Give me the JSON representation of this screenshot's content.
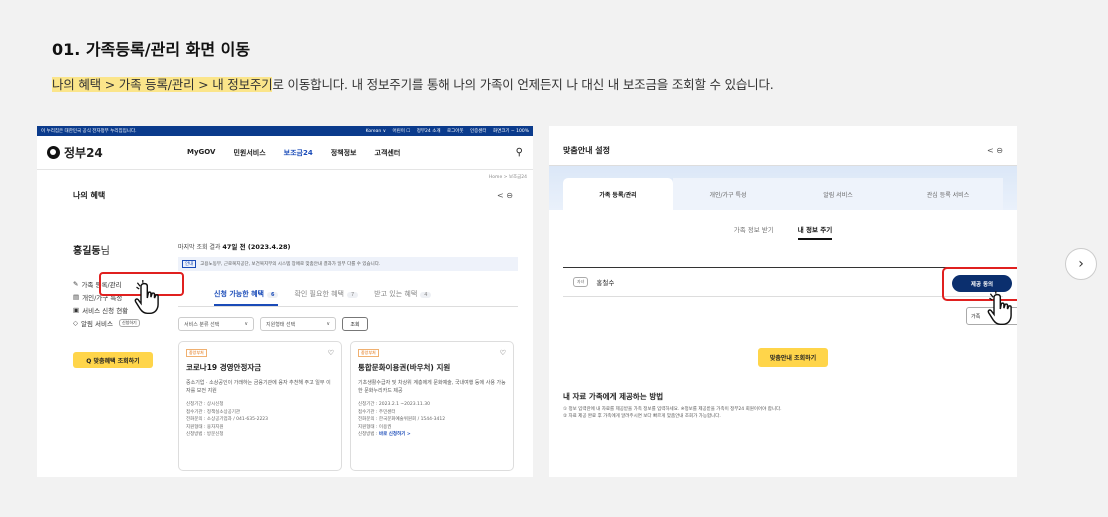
{
  "title": "01. 가족등록/관리 화면 이동",
  "description": {
    "highlight": "나의 혜택 > 가족 등록/관리 > 내 정보주기",
    "rest": "로 이동합니다. 내 정보주기를 통해 나의 가족이 언제든지 나 대신 내 보조금을 조회할 수 있습니다."
  },
  "left": {
    "top_bar": {
      "notice": "이 누리집은 대한민국 공식 전자정부 누리집입니다.",
      "links": [
        "Korean ∨",
        "어린이 ☐",
        "정부24 소개",
        "로그아웃",
        "인증센터",
        "화면크기 − 100%"
      ]
    },
    "logo": "정부24",
    "nav": [
      "MyGOV",
      "민원서비스",
      "보조금24",
      "정책정보",
      "고객센터"
    ],
    "search_icon": "search-icon",
    "breadcrumb": "Home > 보조금24",
    "section_title": "나의 혜택",
    "share_print": "< ⊖",
    "user_name": "홍길동",
    "user_suffix": "님",
    "sidebar": [
      {
        "icon": "✎",
        "label": "가족 등록/관리"
      },
      {
        "icon": "▤",
        "label": "개인/가구 특성"
      },
      {
        "icon": "▣",
        "label": "서비스 신청 현황"
      },
      {
        "icon": "◇",
        "label": "알림 서비스",
        "tag": "신청하기"
      }
    ],
    "search_button": "Q 맞춤혜택 조회하기",
    "last_lookup_label": "마지막 조회 결과",
    "last_lookup_value": "47일 전 (2023.4.28)",
    "note_tag": "안내",
    "note": "고용노동부, 근로복지공단, 보건복지부의 시스템 장애로 맞춤안내 결과가 일부 다를 수 있습니다.",
    "tabs": [
      {
        "label": "신청 가능한 혜택",
        "count": "6"
      },
      {
        "label": "확인 필요한 혜택",
        "count": "7"
      },
      {
        "label": "받고 있는 혜택",
        "count": "4"
      }
    ],
    "filter1": "서비스 분류 선택",
    "filter2": "지원형태 선택",
    "query_button": "조회",
    "cards": [
      {
        "badge": "중앙부처",
        "title": "코로나19 경영안정자금",
        "desc": "중소기업 · 소상공인이 가래하는 금융기관에 융자 추천해 주고 일부 이자를 보전 지원",
        "items": [
          "신청기간 : 상시신청",
          "접수기관 : 정책실소상공기관",
          "전화문의 : 소상공기업과 / 041-635-2223",
          "지원형태 : 융자지원",
          "신청방법 : 방문신청"
        ]
      },
      {
        "badge": "중앙부처",
        "title": "통합문화이용권(바우처) 지원",
        "desc": "기초생활수급자 및 차상위 계층에게 문화예술, 국내여행 등에 사용 가능한 문화누리카드 제공",
        "items": [
          "신청기간 : 2023.2.1 ~2023.11.30",
          "접수기관 : 주민센터",
          "전화문의 : 한국문화예술위원회 / 1544-3412",
          "지원형태 : 이용권"
        ],
        "link_prefix": "신청방법 : ",
        "link": "바로 신청하기 >"
      }
    ]
  },
  "right": {
    "header": "맞춤안내 설정",
    "share_print": "< ⊖",
    "tabs": [
      "가족 등록/관리",
      "개인/가구 특성",
      "알림 서비스",
      "관심 등록 서비스"
    ],
    "subtabs": [
      "가족 정보 받기",
      "내 정보 주기"
    ],
    "relation": "자녀",
    "member": "홍철수",
    "consent_button": "제공 동의",
    "secondary_button": "가족",
    "search_button": "맞춤안내 조회하기",
    "how_title": "내 자료 가족에게 제공하는 방법",
    "how_steps": [
      "① 정보 입력란에 내 자료를 제공받을 가족 정보를 입력하세요. ※정보를 제공받을 가족이 정부24 회원이어야 합니다.",
      "② 자료 제공 완료 후 가족에게 알려주시면 보다 빠르게 맞춤안내 조회가 가능합니다."
    ]
  },
  "next_button": "›"
}
